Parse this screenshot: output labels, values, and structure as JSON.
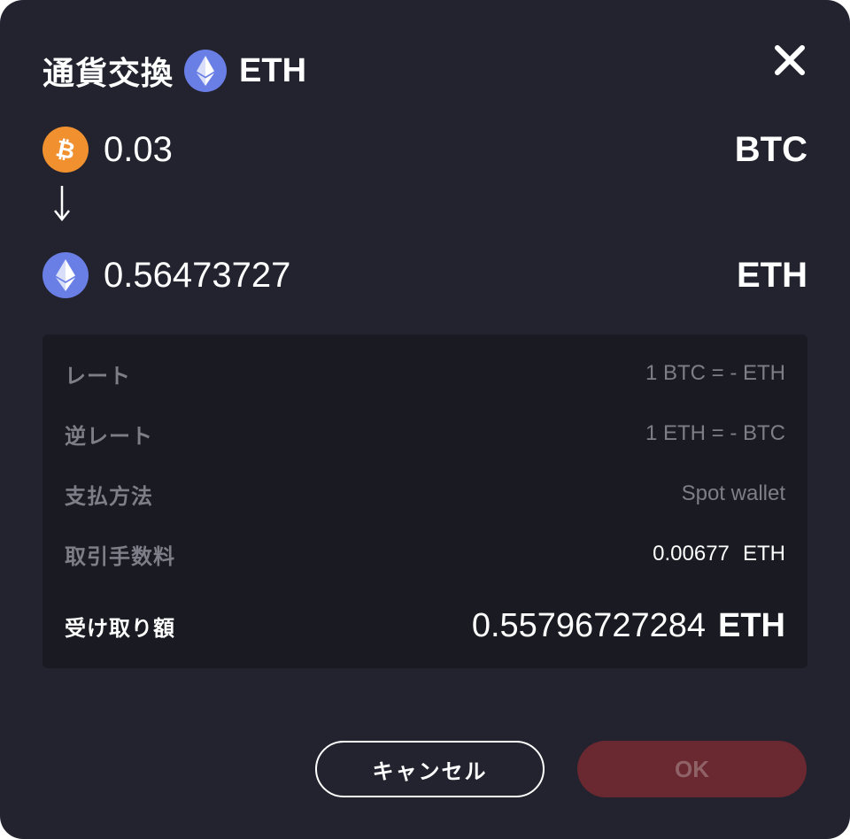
{
  "dialog": {
    "title": "通貨交換",
    "title_coin": "ETH"
  },
  "from": {
    "amount": "0.03",
    "unit": "BTC",
    "icon": "bitcoin-icon"
  },
  "to": {
    "amount": "0.56473727",
    "unit": "ETH",
    "icon": "ethereum-icon"
  },
  "info": {
    "rate_label": "レート",
    "rate_value": "1 BTC = - ETH",
    "inverse_rate_label": "逆レート",
    "inverse_rate_value": "1 ETH = - BTC",
    "payment_label": "支払方法",
    "payment_value": "Spot wallet",
    "fee_label": "取引手数料",
    "fee_value": "0.00677",
    "fee_unit": "ETH",
    "receive_label": "受け取り額",
    "receive_value": "0.55796727284",
    "receive_unit": "ETH"
  },
  "buttons": {
    "cancel": "キャンセル",
    "ok": "OK"
  },
  "colors": {
    "background": "#22232e",
    "panel": "#1a1b22",
    "muted_text": "#7d7e88",
    "bitcoin": "#f0902f",
    "ethereum": "#6a7fe6",
    "ok_button": "#6a2830"
  }
}
